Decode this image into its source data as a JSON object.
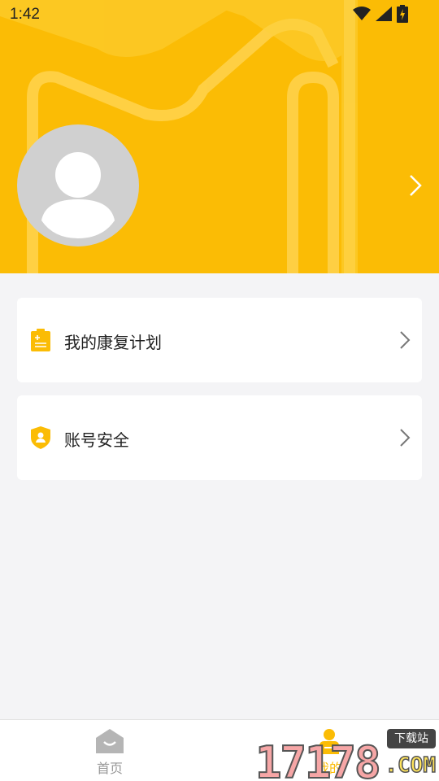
{
  "status_bar": {
    "time": "1:42"
  },
  "colors": {
    "accent": "#FBBC05",
    "background": "#f4f4f6",
    "inactive_tab": "#999999"
  },
  "menu": {
    "items": [
      {
        "label": "我的康复计划",
        "icon": "clipboard-icon"
      },
      {
        "label": "账号安全",
        "icon": "shield-user-icon"
      }
    ]
  },
  "tabbar": {
    "tabs": [
      {
        "label": "首页",
        "icon": "home-icon",
        "active": false
      },
      {
        "label": "我的",
        "icon": "person-icon",
        "active": true
      }
    ]
  },
  "watermark": {
    "number": "17178",
    "suffix": ".COM",
    "badge": "下载站"
  }
}
